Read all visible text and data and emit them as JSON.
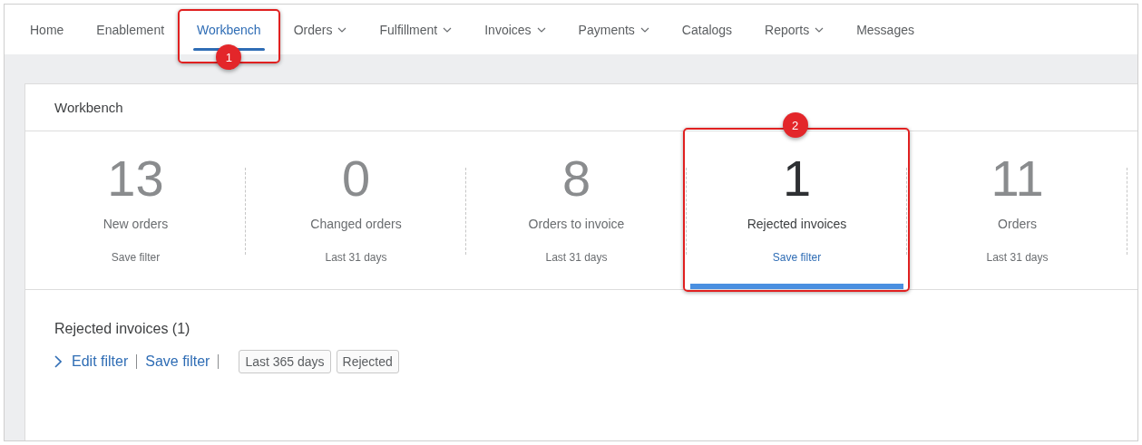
{
  "nav": [
    {
      "label": "Home",
      "selected": false,
      "dropdown": false
    },
    {
      "label": "Enablement",
      "selected": false,
      "dropdown": false
    },
    {
      "label": "Workbench",
      "selected": true,
      "dropdown": false,
      "callout": "1"
    },
    {
      "label": "Orders",
      "selected": false,
      "dropdown": true
    },
    {
      "label": "Fulfillment",
      "selected": false,
      "dropdown": true
    },
    {
      "label": "Invoices",
      "selected": false,
      "dropdown": true
    },
    {
      "label": "Payments",
      "selected": false,
      "dropdown": true
    },
    {
      "label": "Catalogs",
      "selected": false,
      "dropdown": false
    },
    {
      "label": "Reports",
      "selected": false,
      "dropdown": true
    },
    {
      "label": "Messages",
      "selected": false,
      "dropdown": false
    }
  ],
  "card": {
    "title": "Workbench",
    "tiles": [
      {
        "count": "13",
        "label": "New orders",
        "footer": "Save filter",
        "selected": false
      },
      {
        "count": "0",
        "label": "Changed orders",
        "footer": "Last 31 days",
        "selected": false
      },
      {
        "count": "8",
        "label": "Orders to invoice",
        "footer": "Last 31 days",
        "selected": false
      },
      {
        "count": "1",
        "label": "Rejected invoices",
        "footer": "Save filter",
        "selected": true,
        "callout": "2"
      },
      {
        "count": "11",
        "label": "Orders",
        "footer": "Last 31 days",
        "selected": false
      }
    ],
    "results": {
      "title": "Rejected invoices (1)",
      "links": [
        "Edit filter",
        "Save filter"
      ],
      "chips": [
        "Last 365 days",
        "Rejected"
      ]
    }
  }
}
